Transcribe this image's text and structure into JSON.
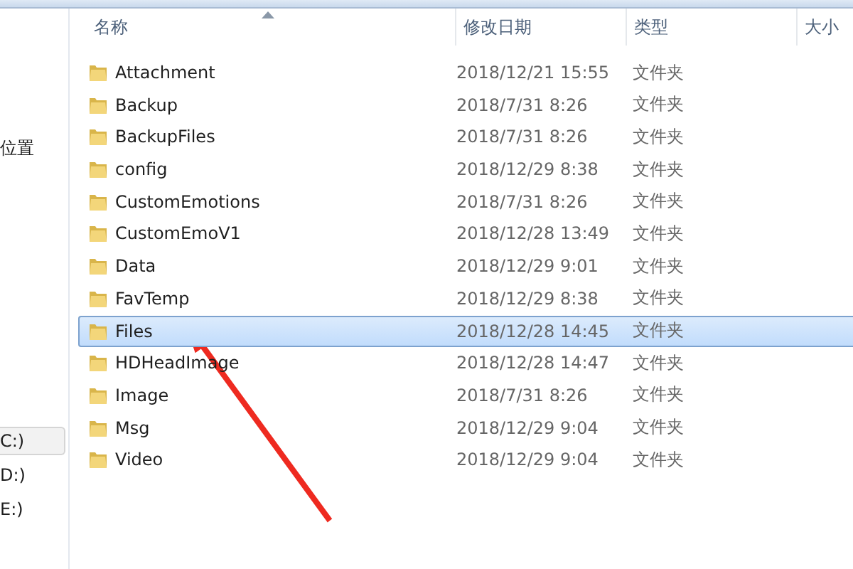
{
  "sidebar": {
    "items": [
      {
        "label": "位置",
        "selected": false
      },
      {
        "label": "C:)",
        "selected": true
      },
      {
        "label": "D:)",
        "selected": false
      },
      {
        "label": "E:)",
        "selected": false
      }
    ]
  },
  "table": {
    "columns": [
      "名称",
      "修改日期",
      "类型",
      "大小"
    ],
    "rows": [
      {
        "name": "Attachment",
        "modified": "2018/12/21 15:55",
        "type": "文件夹",
        "selected": false
      },
      {
        "name": "Backup",
        "modified": "2018/7/31 8:26",
        "type": "文件夹",
        "selected": false
      },
      {
        "name": "BackupFiles",
        "modified": "2018/7/31 8:26",
        "type": "文件夹",
        "selected": false
      },
      {
        "name": "config",
        "modified": "2018/12/29 8:38",
        "type": "文件夹",
        "selected": false
      },
      {
        "name": "CustomEmotions",
        "modified": "2018/7/31 8:26",
        "type": "文件夹",
        "selected": false
      },
      {
        "name": "CustomEmoV1",
        "modified": "2018/12/28 13:49",
        "type": "文件夹",
        "selected": false
      },
      {
        "name": "Data",
        "modified": "2018/12/29 9:01",
        "type": "文件夹",
        "selected": false
      },
      {
        "name": "FavTemp",
        "modified": "2018/12/29 8:38",
        "type": "文件夹",
        "selected": false
      },
      {
        "name": "Files",
        "modified": "2018/12/28 14:45",
        "type": "文件夹",
        "selected": true
      },
      {
        "name": "HDHeadImage",
        "modified": "2018/12/28 14:47",
        "type": "文件夹",
        "selected": false
      },
      {
        "name": "Image",
        "modified": "2018/7/31 8:26",
        "type": "文件夹",
        "selected": false
      },
      {
        "name": "Msg",
        "modified": "2018/12/29 9:04",
        "type": "文件夹",
        "selected": false
      },
      {
        "name": "Video",
        "modified": "2018/12/29 9:04",
        "type": "文件夹",
        "selected": false
      }
    ]
  }
}
